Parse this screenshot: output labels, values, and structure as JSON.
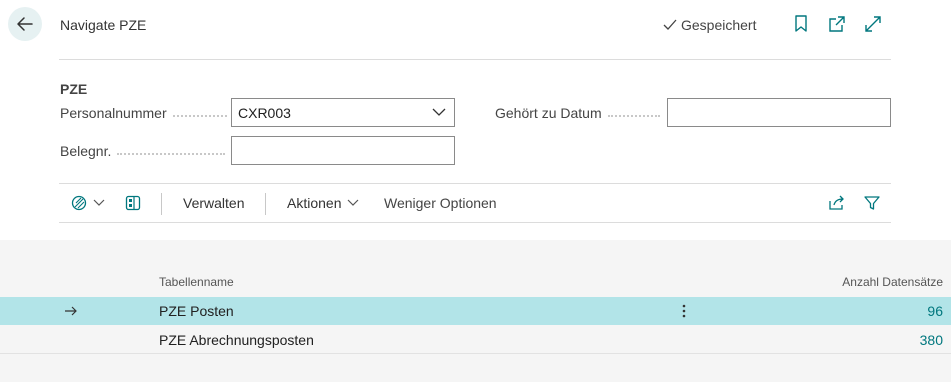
{
  "header": {
    "back_icon": "arrow-left-icon",
    "title": "Navigate PZE",
    "saved_label": "Gespeichert",
    "icons": [
      "bookmark-icon",
      "open-in-new-window-icon",
      "expand-icon"
    ]
  },
  "form": {
    "group_title": "PZE",
    "personalnummer_label": "Personalnummer",
    "personalnummer_value": "CXR003",
    "datum_label": "Gehört zu Datum",
    "datum_value": "",
    "belegnr_label": "Belegnr.",
    "belegnr_value": ""
  },
  "action_bar": {
    "verwalten_label": "Verwalten",
    "aktionen_label": "Aktionen",
    "weniger_label": "Weniger Optionen"
  },
  "table": {
    "col_name": "Tabellenname",
    "col_count": "Anzahl Datensätze",
    "rows": [
      {
        "name": "PZE Posten",
        "count": "96",
        "selected": true
      },
      {
        "name": "PZE Abrechnungsposten",
        "count": "380",
        "selected": false
      }
    ]
  },
  "colors": {
    "accent": "#00777e",
    "selected_row": "#b2e4e8",
    "back_button_bg": "#e6f1f2"
  }
}
